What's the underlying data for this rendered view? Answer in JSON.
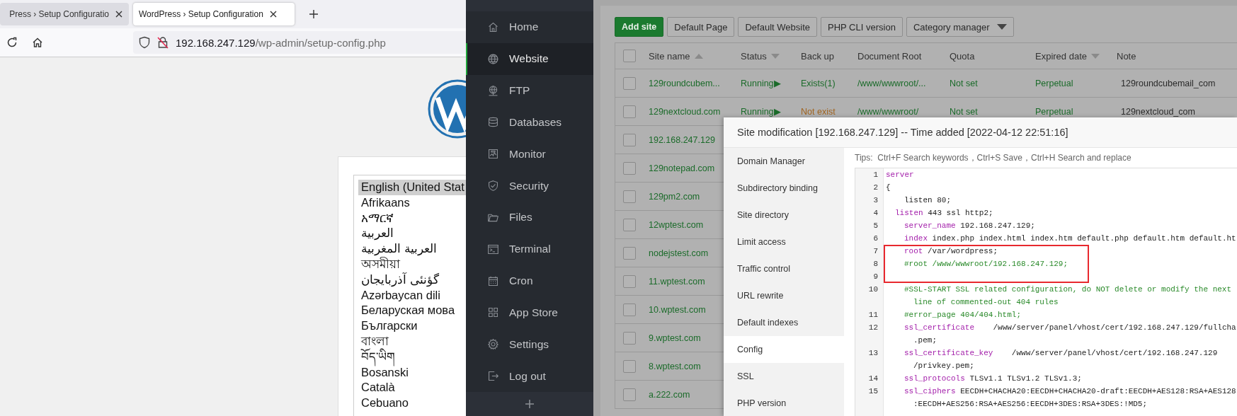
{
  "browser": {
    "tabs": [
      {
        "title": "Press › Setup Configuratio",
        "selected": false
      },
      {
        "title": "WordPress › Setup Configuration",
        "selected": true
      }
    ],
    "address": {
      "host": "192.168.247.129",
      "path": "/wp-admin/setup-config.php"
    },
    "languages": [
      {
        "label": "English (United Stat",
        "selected": true
      },
      {
        "label": "Afrikaans",
        "selected": false
      },
      {
        "label": "አማርኛ",
        "selected": false
      },
      {
        "label": "العربية",
        "selected": false
      },
      {
        "label": "العربية المغربية",
        "selected": false
      },
      {
        "label": "অসমীয়া",
        "selected": false
      },
      {
        "label": "گؤنئی آذربایجان",
        "selected": false
      },
      {
        "label": "Azərbaycan dili",
        "selected": false
      },
      {
        "label": "Беларуская мова",
        "selected": false
      },
      {
        "label": "Български",
        "selected": false
      },
      {
        "label": "বাংলা",
        "selected": false
      },
      {
        "label": "བོད་ཡིག",
        "selected": false
      },
      {
        "label": "Bosanski",
        "selected": false
      },
      {
        "label": "Català",
        "selected": false
      },
      {
        "label": "Cebuano",
        "selected": false
      }
    ]
  },
  "sidebar": {
    "items": [
      {
        "label": "Home",
        "selected": false
      },
      {
        "label": "Website",
        "selected": true
      },
      {
        "label": "FTP",
        "selected": false
      },
      {
        "label": "Databases",
        "selected": false
      },
      {
        "label": "Monitor",
        "selected": false
      },
      {
        "label": "Security",
        "selected": false
      },
      {
        "label": "Files",
        "selected": false
      },
      {
        "label": "Terminal",
        "selected": false
      },
      {
        "label": "Cron",
        "selected": false
      },
      {
        "label": "App Store",
        "selected": false
      },
      {
        "label": "Settings",
        "selected": false
      },
      {
        "label": "Log out",
        "selected": false
      }
    ]
  },
  "toolbar": {
    "buttons": [
      {
        "label": "Add site",
        "kind": "primary"
      },
      {
        "label": "Default Page",
        "kind": "plain"
      },
      {
        "label": "Default Website",
        "kind": "plain"
      },
      {
        "label": "PHP CLI version",
        "kind": "plain"
      },
      {
        "label": "Category manager",
        "kind": "dropdown"
      }
    ]
  },
  "table": {
    "header_checked": false,
    "columns": [
      {
        "label": "Site name",
        "sorted": true,
        "ascending": true
      },
      {
        "label": "Status",
        "sorted": true,
        "ascending": false
      },
      {
        "label": "Back up",
        "sorted": false
      },
      {
        "label": "Document Root",
        "sorted": false
      },
      {
        "label": "Quota",
        "sorted": false
      },
      {
        "label": "Expired date",
        "sorted": true,
        "ascending": false
      },
      {
        "label": "Note",
        "sorted": false
      }
    ],
    "rows": [
      {
        "checked": false,
        "site_name": "129roundcubem...",
        "status": "Running▶",
        "backup": "Exists(1)",
        "backup_exists": true,
        "document_root": "/www/wwwroot/...",
        "quota": "Not set",
        "expired": "Perpetual",
        "note": "129roundcubemail_com"
      },
      {
        "checked": false,
        "site_name": "129nextcloud.com",
        "status": "Running▶",
        "backup": "Not exist",
        "backup_exists": false,
        "document_root": "/www/wwwroot/",
        "quota": "Not set",
        "expired": "Perpetual",
        "note": "129nextcloud_com"
      },
      {
        "checked": false,
        "site_name": "192.168.247.129"
      },
      {
        "checked": false,
        "site_name": "129notepad.com"
      },
      {
        "checked": false,
        "site_name": "129pm2.com"
      },
      {
        "checked": false,
        "site_name": "12wptest.com"
      },
      {
        "checked": false,
        "site_name": "nodejstest.com"
      },
      {
        "checked": false,
        "site_name": "11.wptest.com"
      },
      {
        "checked": false,
        "site_name": "10.wptest.com"
      },
      {
        "checked": false,
        "site_name": "9.wptest.com"
      },
      {
        "checked": false,
        "site_name": "8.wptest.com"
      },
      {
        "checked": false,
        "site_name": "a.222.com"
      }
    ]
  },
  "modal": {
    "title": "Site modification [192.168.247.129] -- Time added [2022-04-12 22:51:16]",
    "menu": [
      {
        "label": "Domain Manager",
        "selected": false
      },
      {
        "label": "Subdirectory binding",
        "selected": false
      },
      {
        "label": "Site directory",
        "selected": false
      },
      {
        "label": "Limit access",
        "selected": false
      },
      {
        "label": "Traffic control",
        "selected": false
      },
      {
        "label": "URL rewrite",
        "selected": false
      },
      {
        "label": "Default indexes",
        "selected": false
      },
      {
        "label": "Config",
        "selected": true
      },
      {
        "label": "SSL",
        "selected": false
      },
      {
        "label": "PHP version",
        "selected": false
      }
    ],
    "tips": "Tips:  Ctrl+F Search keywords，Ctrl+S Save，Ctrl+H Search and replace",
    "code": [
      {
        "number": "1",
        "kind": "top",
        "highlighted": false,
        "segments": [
          {
            "kind": "keyword",
            "text": "server"
          }
        ]
      },
      {
        "number": "2",
        "kind": "top",
        "highlighted": false,
        "segments": [
          {
            "kind": "plain",
            "text": "{"
          }
        ]
      },
      {
        "number": "3",
        "kind": "inner",
        "highlighted": false,
        "segments": [
          {
            "kind": "plain",
            "text": "listen 80;"
          }
        ]
      },
      {
        "number": "4",
        "kind": "shallow",
        "highlighted": false,
        "segments": [
          {
            "kind": "keyword",
            "text": "listen"
          },
          {
            "kind": "plain",
            "text": " 443 ssl http2;"
          }
        ]
      },
      {
        "number": "5",
        "kind": "inner",
        "highlighted": false,
        "segments": [
          {
            "kind": "keyword",
            "text": "server_name"
          },
          {
            "kind": "plain",
            "text": " 192.168.247.129;"
          }
        ]
      },
      {
        "number": "6",
        "kind": "inner",
        "highlighted": false,
        "segments": [
          {
            "kind": "keyword",
            "text": "index"
          },
          {
            "kind": "plain",
            "text": " index.php index.html index.htm default.php default.htm default.ht"
          }
        ]
      },
      {
        "number": "7",
        "kind": "inner",
        "highlighted": true,
        "segments": [
          {
            "kind": "keyword",
            "text": "root"
          },
          {
            "kind": "plain",
            "text": " /var/wordpress;"
          }
        ]
      },
      {
        "number": "8",
        "kind": "inner",
        "highlighted": true,
        "segments": [
          {
            "kind": "comment",
            "text": "#root /www/wwwroot/192.168.247.129;"
          }
        ]
      },
      {
        "number": "9",
        "kind": "inner",
        "highlighted": true
      },
      {
        "number": "10",
        "kind": "inner",
        "highlighted": false,
        "segments": [
          {
            "kind": "comment",
            "text": "#SSL-START SSL related configuration, do NOT delete or modify the next"
          }
        ]
      },
      {
        "kind": "wrap",
        "highlighted": false,
        "segments": [
          {
            "kind": "comment",
            "text": "line of commented-out 404 rules"
          }
        ]
      },
      {
        "number": "11",
        "kind": "inner",
        "highlighted": false,
        "segments": [
          {
            "kind": "comment",
            "text": "#error_page 404/404.html;"
          }
        ]
      },
      {
        "number": "12",
        "kind": "inner",
        "highlighted": false,
        "segments": [
          {
            "kind": "keyword",
            "text": "ssl_certificate"
          },
          {
            "kind": "plain",
            "text": "    /www/server/panel/vhost/cert/192.168.247.129/fullcha"
          }
        ]
      },
      {
        "kind": "wrap",
        "highlighted": false,
        "segments": [
          {
            "kind": "plain",
            "text": ".pem;"
          }
        ]
      },
      {
        "number": "13",
        "kind": "inner",
        "highlighted": false,
        "segments": [
          {
            "kind": "keyword",
            "text": "ssl_certificate_key"
          },
          {
            "kind": "plain",
            "text": "    /www/server/panel/vhost/cert/192.168.247.129"
          }
        ]
      },
      {
        "kind": "wrap",
        "highlighted": false,
        "segments": [
          {
            "kind": "plain",
            "text": "/privkey.pem;"
          }
        ]
      },
      {
        "number": "14",
        "kind": "inner",
        "highlighted": false,
        "segments": [
          {
            "kind": "keyword",
            "text": "ssl_protocols"
          },
          {
            "kind": "plain",
            "text": " TLSv1.1 TLSv1.2 TLSv1.3;"
          }
        ]
      },
      {
        "number": "15",
        "kind": "inner",
        "highlighted": false,
        "segments": [
          {
            "kind": "keyword",
            "text": "ssl_ciphers"
          },
          {
            "kind": "plain",
            "text": " EECDH+CHACHA20:EECDH+CHACHA20-draft:EECDH+AES128:RSA+AES128"
          }
        ]
      },
      {
        "kind": "wrap",
        "highlighted": false,
        "segments": [
          {
            "kind": "plain",
            "text": ":EECDH+AES256:RSA+AES256:EECDH+3DES:RSA+3DES:!MD5;"
          }
        ]
      }
    ]
  }
}
